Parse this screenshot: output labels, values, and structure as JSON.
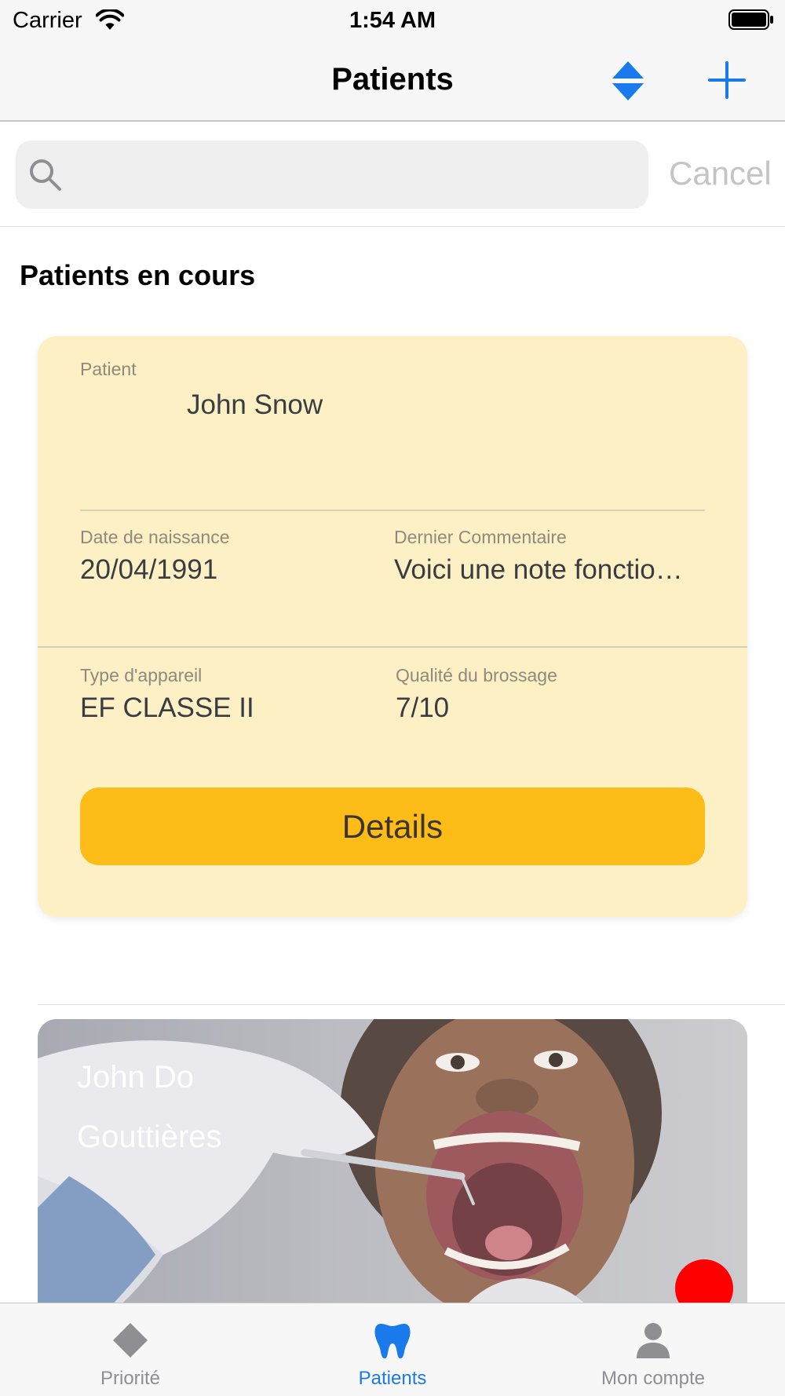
{
  "status_bar": {
    "carrier": "Carrier",
    "time": "1:54 AM"
  },
  "nav": {
    "title": "Patients"
  },
  "search": {
    "placeholder": "",
    "cancel_label": "Cancel"
  },
  "section_title": "Patients en cours",
  "current_patient": {
    "patient_label": "Patient",
    "patient_name": "John Snow",
    "dob_label": "Date de naissance",
    "dob": "20/04/1991",
    "comment_label": "Dernier Commentaire",
    "comment": "Voici une note fonctio…",
    "device_label": "Type d'appareil",
    "device": "EF CLASSE II",
    "brushing_label": "Qualité du brossage",
    "brushing": "7/10",
    "details_button": "Details"
  },
  "patient_card_2": {
    "name": "John Do",
    "device_type": "Gouttières",
    "status_color": "#ff0000"
  },
  "tabs": [
    {
      "label": "Priorité",
      "icon": "diamond-icon",
      "active": false
    },
    {
      "label": "Patients",
      "icon": "tooth-icon",
      "active": true
    },
    {
      "label": "Mon compte",
      "icon": "person-icon",
      "active": false
    }
  ],
  "colors": {
    "accent": "#1a7aeb",
    "card_background": "#fdf0c4",
    "details_button": "#fdbc18",
    "inactive_tab": "#8e8e93"
  }
}
